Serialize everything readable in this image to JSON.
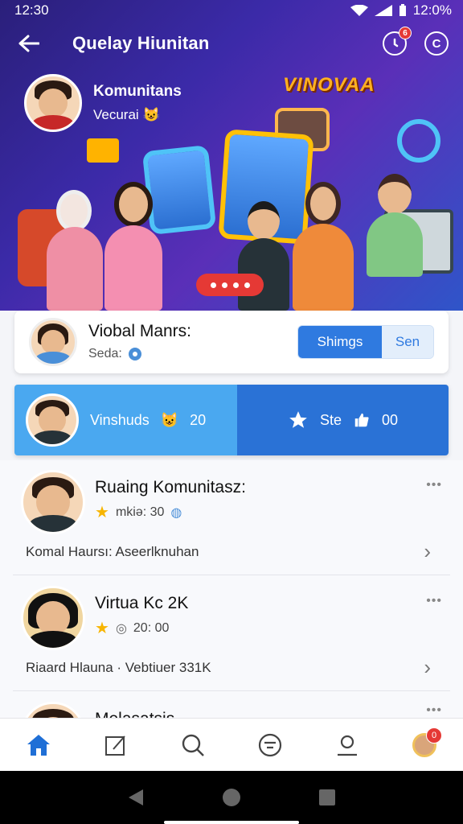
{
  "status": {
    "time": "12:30",
    "right": "12:0%"
  },
  "header": {
    "title": "Quelay Hiunitan"
  },
  "hero": {
    "profile_name": "Komunitans",
    "profile_sub": "Vecurai",
    "brand": "VINOVAA"
  },
  "profile_card": {
    "name": "Viobal Manrs:",
    "sub": "Seda:",
    "tab_active": "Shimgs",
    "tab_inactive": "Sen"
  },
  "stats_card": {
    "left_label": "Vinshuds",
    "left_value": "20",
    "right_label": "Ste",
    "right_value": "00"
  },
  "list": [
    {
      "name": "Ruaing Komunitasz:",
      "meta": "mkiə: 30",
      "footer": "Komal Haursı: Aseerlknuhan"
    },
    {
      "name": "Virtua Kc 2K",
      "meta": "20: 00",
      "footer": "Riaard Hlauna · Vebtiuer 331K"
    },
    {
      "name": "Melasatsis",
      "meta": "",
      "footer": ""
    }
  ],
  "colors": {
    "accent": "#2f7ae0",
    "hero_start": "#2a1f7a",
    "hero_end": "#2f55c9",
    "badge": "#e53935"
  },
  "nav": {
    "badge": "0"
  }
}
